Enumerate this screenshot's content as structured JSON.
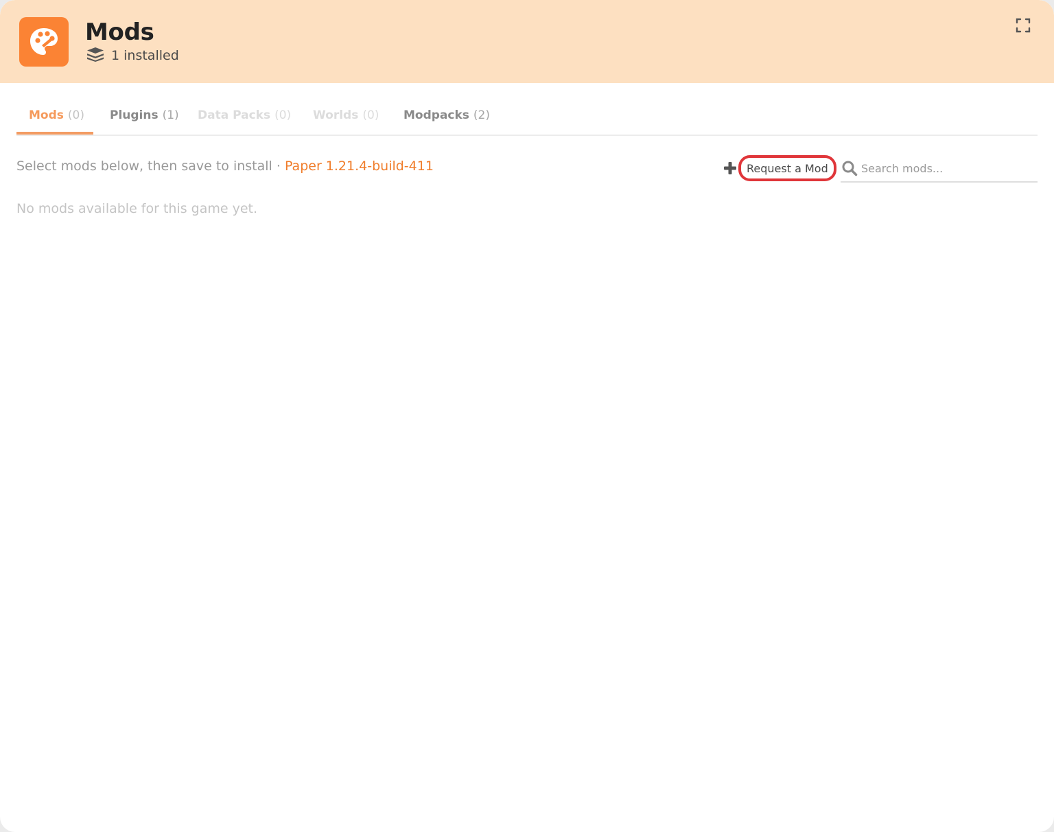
{
  "header": {
    "title": "Mods",
    "installed_text": "1 installed",
    "app_icon": "palette-icon",
    "installed_icon": "layers-stack-icon",
    "expand_icon": "expand-icon"
  },
  "tabs": [
    {
      "label": "Mods",
      "count": "(0)",
      "state": "active"
    },
    {
      "label": "Plugins",
      "count": "(1)",
      "state": "normal"
    },
    {
      "label": "Data Packs",
      "count": "(0)",
      "state": "disabled"
    },
    {
      "label": "Worlds",
      "count": "(0)",
      "state": "disabled"
    },
    {
      "label": "Modpacks",
      "count": "(2)",
      "state": "normal"
    }
  ],
  "toolbar": {
    "instructions": "Select mods below, then save to install ·",
    "version": "Paper 1.21.4-build-411",
    "request_label": "Request a Mod",
    "search_placeholder": "Search mods..."
  },
  "empty_state": "No mods available for this game yet.",
  "colors": {
    "header_bg": "#fde0c1",
    "accent": "#fb8334",
    "active_tab": "#f59a5c",
    "version_text": "#f07d2b",
    "highlight_ring": "#e0363a"
  }
}
